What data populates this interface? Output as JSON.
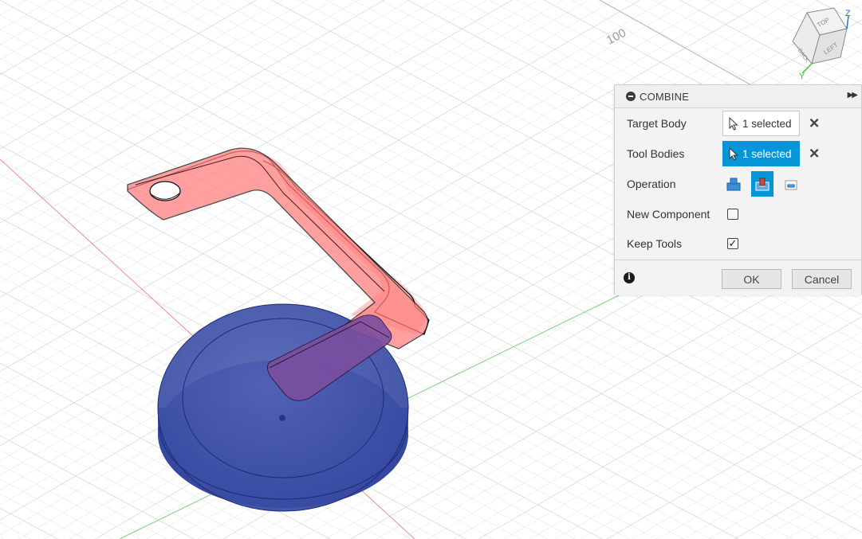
{
  "viewport": {
    "grid_label": "100"
  },
  "viewcube": {
    "faces": {
      "top": "TOP",
      "back": "BACK",
      "left": "LEFT"
    },
    "axes": {
      "z": "Z",
      "y": "Y"
    }
  },
  "dialog": {
    "title": "COMBINE",
    "target_body": {
      "label": "Target Body",
      "value": "1 selected"
    },
    "tool_bodies": {
      "label": "Tool Bodies",
      "value": "1 selected"
    },
    "operation": {
      "label": "Operation",
      "options": [
        "join-icon",
        "cut-icon",
        "intersect-icon"
      ],
      "selected": 1
    },
    "new_component": {
      "label": "New Component",
      "checked": false
    },
    "keep_tools": {
      "label": "Keep Tools",
      "checked": true,
      "mark": "✓"
    },
    "ok_label": "OK",
    "cancel_label": "Cancel"
  },
  "colors": {
    "accent": "#0696d7",
    "tool_body": "#ff8a8a",
    "target_body": "#3f51a8"
  }
}
